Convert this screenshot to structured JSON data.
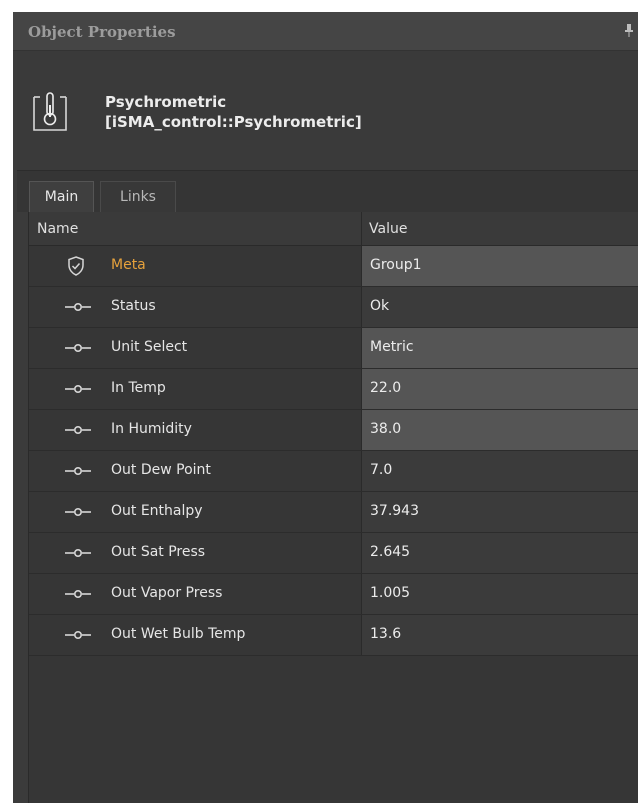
{
  "panel": {
    "title": "Object Properties",
    "pin_icon": "pin-icon"
  },
  "object": {
    "icon": "thermometer-icon",
    "name_line1": "Psychrometric",
    "name_line2": "[iSMA_control::Psychrometric]"
  },
  "tabs": [
    {
      "label": "Main",
      "active": true
    },
    {
      "label": "Links",
      "active": false
    }
  ],
  "grid": {
    "columns": {
      "name": "Name",
      "value": "Value"
    },
    "rows": [
      {
        "icon": "shield-icon",
        "name": "Meta",
        "value": "Group1",
        "editable": true
      },
      {
        "icon": "slot-icon",
        "name": "Status",
        "value": "Ok",
        "editable": false
      },
      {
        "icon": "slot-icon",
        "name": "Unit Select",
        "value": "Metric",
        "editable": true
      },
      {
        "icon": "slot-icon",
        "name": "In Temp",
        "value": "22.0",
        "editable": true
      },
      {
        "icon": "slot-icon",
        "name": "In Humidity",
        "value": "38.0",
        "editable": true
      },
      {
        "icon": "slot-icon",
        "name": "Out Dew Point",
        "value": "7.0",
        "editable": false
      },
      {
        "icon": "slot-icon",
        "name": "Out Enthalpy",
        "value": "37.943",
        "editable": false
      },
      {
        "icon": "slot-icon",
        "name": "Out Sat Press",
        "value": "2.645",
        "editable": false
      },
      {
        "icon": "slot-icon",
        "name": "Out Vapor Press",
        "value": "1.005",
        "editable": false
      },
      {
        "icon": "slot-icon",
        "name": "Out Wet Bulb Temp",
        "value": "13.6",
        "editable": false
      }
    ]
  },
  "colors": {
    "meta_label": "#e6a23c",
    "editable_value_bg": "#555555",
    "panel_bg": "#3b3b3b"
  }
}
